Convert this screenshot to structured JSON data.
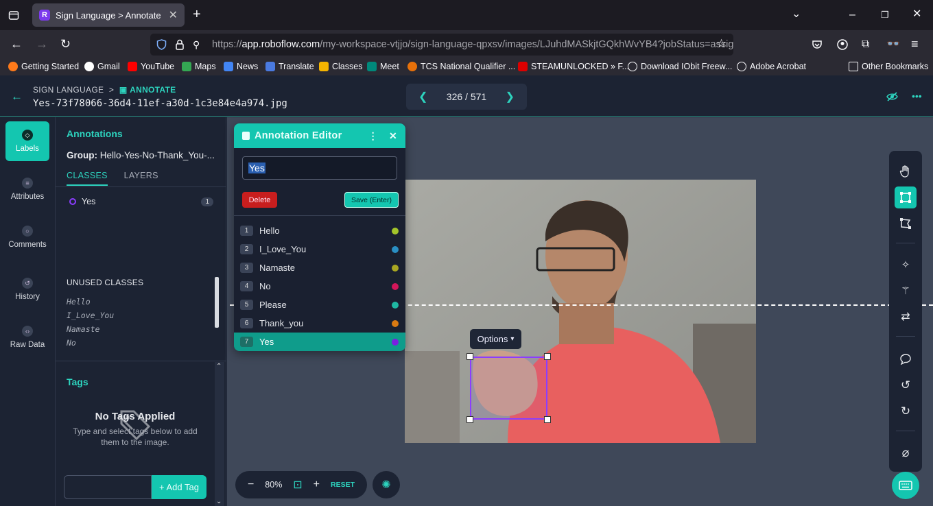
{
  "browser": {
    "tab_title": "Sign Language > Annotate",
    "url_domain": "app.roboflow.com",
    "url_prefix": "https://",
    "url_path": "/my-workspace-vtjjo/sign-language-qpxsv/images/LJuhdMASkjtGQkhWvYB4?jobStatus=assig",
    "bookmarks": [
      "Getting Started",
      "Gmail",
      "YouTube",
      "Maps",
      "News",
      "Translate",
      "Classes",
      "Meet",
      "TCS National Qualifier ...",
      "STEAMUNLOCKED » F...",
      "Download IObit Freew...",
      "Adobe Acrobat"
    ],
    "other_bookmarks": "Other Bookmarks"
  },
  "header": {
    "crumb_project": "SIGN LANGUAGE",
    "crumb_sep": ">",
    "crumb_current": "ANNOTATE",
    "filename": "Yes-73f78066-36d4-11ef-a30d-1c3e84e4a974.jpg",
    "pager": "326 / 571"
  },
  "rail": {
    "items": [
      {
        "label": "Labels",
        "icon": "label-icon"
      },
      {
        "label": "Attributes",
        "icon": "list-icon"
      },
      {
        "label": "Comments",
        "icon": "comment-icon"
      },
      {
        "label": "History",
        "icon": "history-icon"
      },
      {
        "label": "Raw Data",
        "icon": "code-icon"
      }
    ]
  },
  "panel": {
    "title": "Annotations",
    "group_label": "Group:",
    "group_value": "Hello-Yes-No-Thank_You-...",
    "tab_classes": "CLASSES",
    "tab_layers": "LAYERS",
    "used_class": "Yes",
    "used_count": "1",
    "unused_heading": "UNUSED CLASSES",
    "unused": [
      "Hello",
      "I_Love_You",
      "Namaste",
      "No"
    ],
    "tags_title": "Tags",
    "no_tags": "No Tags Applied",
    "no_tags_sub": "Type and select tags below to add them to the image.",
    "add_tag": "+ Add Tag"
  },
  "editor": {
    "title": "Annotation Editor",
    "input_value": "Yes",
    "delete": "Delete",
    "save": "Save (Enter)",
    "classes": [
      {
        "n": "1",
        "name": "Hello",
        "color": "#a3c42a"
      },
      {
        "n": "2",
        "name": "I_Love_You",
        "color": "#2a8fc4"
      },
      {
        "n": "3",
        "name": "Namaste",
        "color": "#a8a622"
      },
      {
        "n": "4",
        "name": "No",
        "color": "#d3165a"
      },
      {
        "n": "5",
        "name": "Please",
        "color": "#1fb8a2"
      },
      {
        "n": "6",
        "name": "Thank_you",
        "color": "#d97a12"
      },
      {
        "n": "7",
        "name": "Yes",
        "color": "#7a1fe0"
      }
    ],
    "selected_index": 6
  },
  "canvas": {
    "options_label": "Options"
  },
  "zoom": {
    "value": "80%",
    "reset": "RESET"
  },
  "colors": {
    "accent": "#14c6b0",
    "bbox": "#8b3dff",
    "danger": "#c81e1e"
  }
}
